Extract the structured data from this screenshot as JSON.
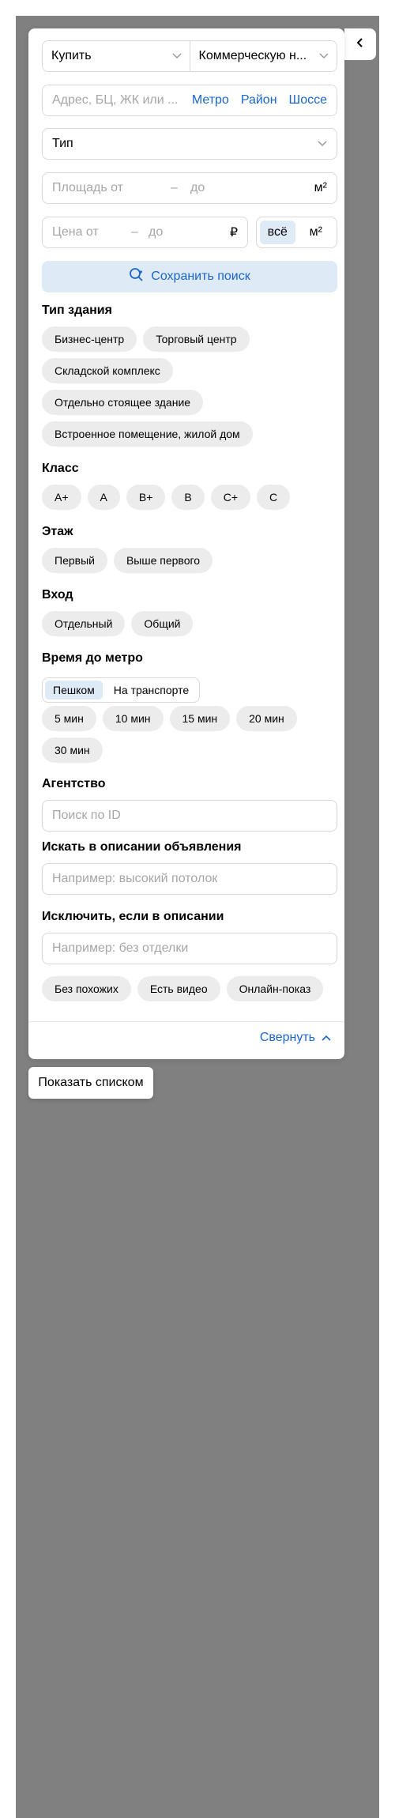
{
  "filters": {
    "deal_type": "Купить",
    "property_type": "Коммерческую н...",
    "address_placeholder": "Адрес, БЦ, ЖК или ...",
    "address_links": [
      "Метро",
      "Район",
      "Шоссе"
    ],
    "type_label": "Тип",
    "area": {
      "from_placeholder": "Площадь от",
      "dash": "–",
      "to_placeholder": "до",
      "unit": "м²"
    },
    "price": {
      "from_placeholder": "Цена от",
      "dash": "–",
      "to_placeholder": "до",
      "currency": "₽"
    },
    "price_units": [
      {
        "label": "всё",
        "selected": true
      },
      {
        "label": "м²",
        "selected": false
      }
    ],
    "save_search": "Сохранить поиск"
  },
  "sections": {
    "building_type": {
      "title": "Тип здания",
      "options": [
        "Бизнес-центр",
        "Торговый центр",
        "Складской комплекс",
        "Отдельно стоящее здание",
        "Встроенное помещение, жилой дом"
      ]
    },
    "class": {
      "title": "Класс",
      "options": [
        "A+",
        "A",
        "B+",
        "B",
        "C+",
        "C"
      ]
    },
    "floor": {
      "title": "Этаж",
      "options": [
        "Первый",
        "Выше первого"
      ]
    },
    "entrance": {
      "title": "Вход",
      "options": [
        "Отдельный",
        "Общий"
      ]
    },
    "metro_time": {
      "title": "Время до метро",
      "modes": [
        {
          "label": "Пешком",
          "selected": true
        },
        {
          "label": "На транспорте",
          "selected": false
        }
      ],
      "options": [
        "5 мин",
        "10 мин",
        "15 мин",
        "20 мин",
        "30 мин"
      ]
    },
    "agency": {
      "title": "Агентство",
      "placeholder": "Поиск по ID"
    },
    "description_search": {
      "title": "Искать в описании объявления",
      "placeholder": "Например: высокий потолок"
    },
    "description_exclude": {
      "title": "Исключить, если в описании",
      "placeholder": "Например: без отделки"
    },
    "extras": [
      "Без похожих",
      "Есть видео",
      "Онлайн-показ"
    ]
  },
  "footer": {
    "collapse_label": "Свернуть"
  },
  "show_list": "Показать списком",
  "colors": {
    "accent": "#1a66c9",
    "selected_bg": "#dfeaf7",
    "chip_bg": "#ececec",
    "map_bg": "#808080"
  }
}
